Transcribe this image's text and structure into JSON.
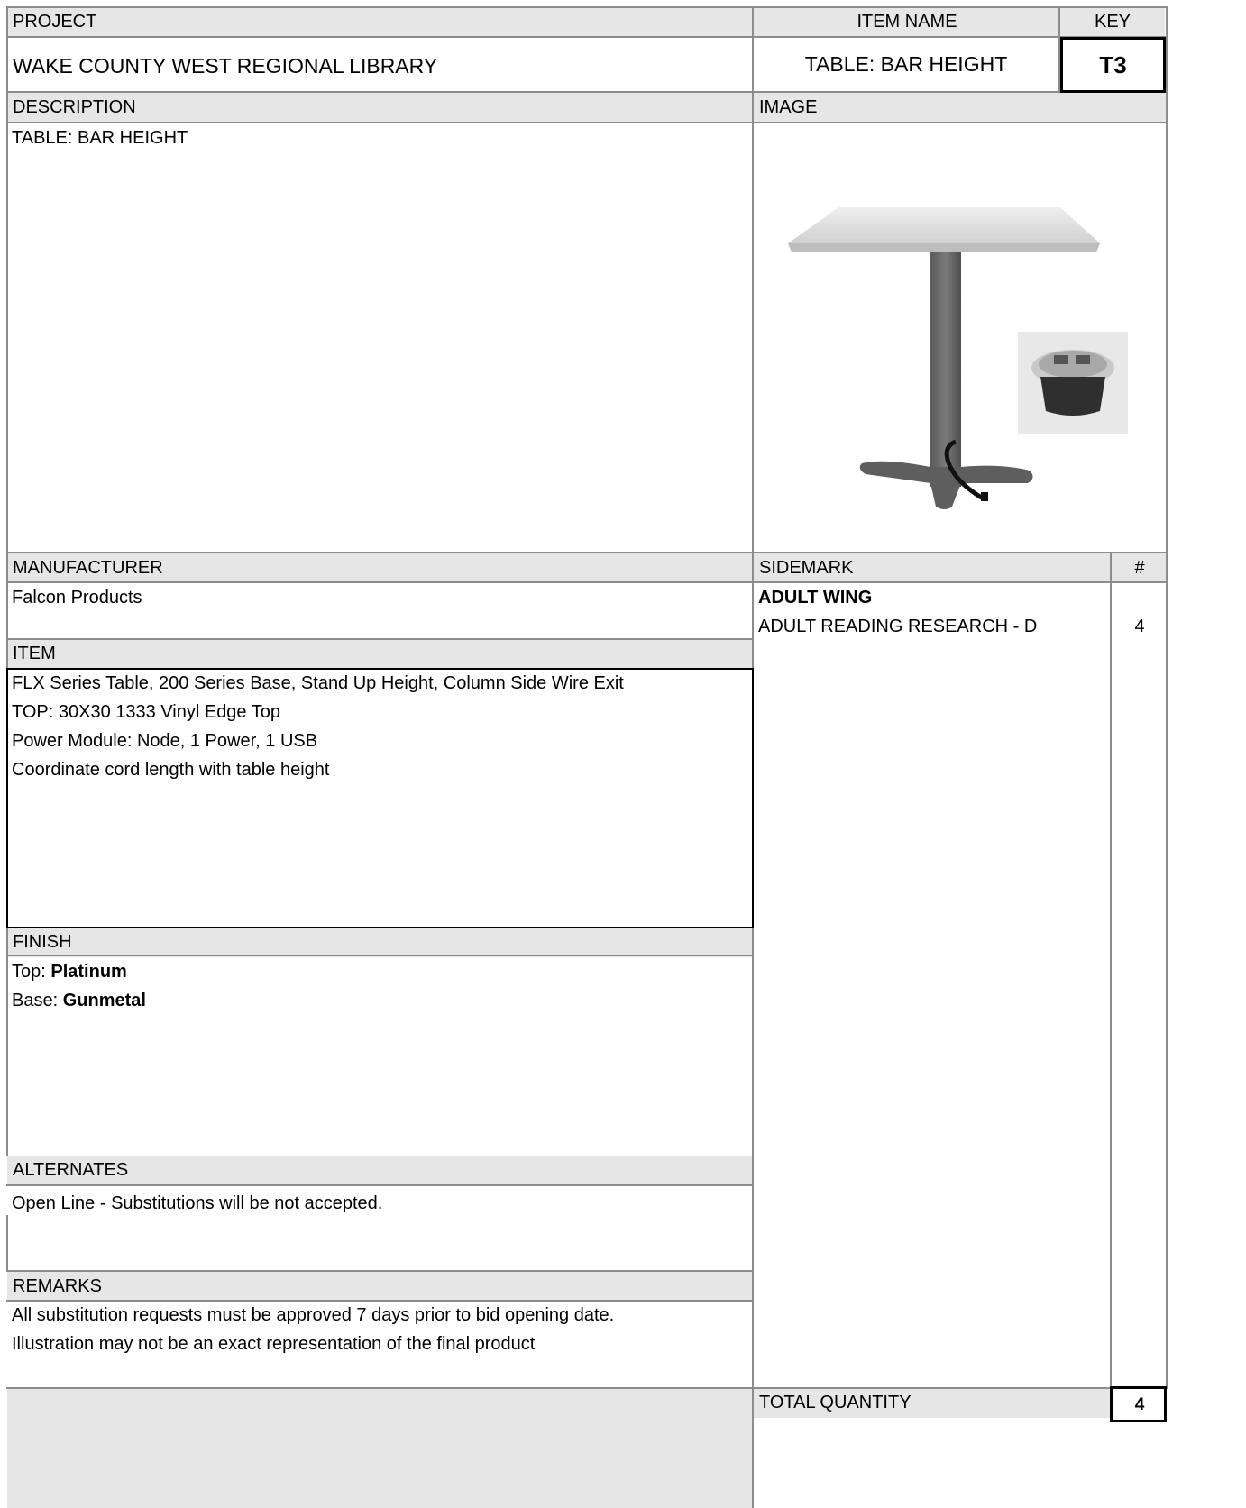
{
  "project": {
    "label": "PROJECT",
    "value": "WAKE COUNTY WEST REGIONAL LIBRARY"
  },
  "item_name": {
    "label": "ITEM NAME",
    "value": "TABLE: BAR HEIGHT"
  },
  "key": {
    "label": "KEY",
    "value": "T3"
  },
  "description": {
    "label": "DESCRIPTION",
    "value": "TABLE: BAR HEIGHT"
  },
  "image": {
    "label": "IMAGE",
    "main_icon": "bar-height-table-icon",
    "inset_icon": "power-module-icon",
    "colors": {
      "tabletop": "#e4e4e4",
      "base": "#606060",
      "inset_bg": "#e8e8e8"
    }
  },
  "manufacturer": {
    "label": "MANUFACTURER",
    "value": "Falcon Products"
  },
  "item": {
    "label": "ITEM",
    "lines": [
      "FLX Series Table, 200 Series Base, Stand Up Height, Column Side Wire Exit",
      "TOP: 30X30 1333 Vinyl Edge Top",
      "Power Module: Node, 1 Power, 1 USB",
      "Coordinate cord length with table height"
    ]
  },
  "finish": {
    "label": "FINISH",
    "top_label": "Top:",
    "top_value": "Platinum",
    "base_label": "Base:",
    "base_value": "Gunmetal"
  },
  "alternates": {
    "label": "ALTERNATES",
    "value": "Open Line - Substitutions will be not accepted."
  },
  "remarks": {
    "label": "REMARKS",
    "lines": [
      "All substitution requests must be approved 7 days prior to bid opening date.",
      "Illustration may not be an exact representation of the final product"
    ]
  },
  "sidemark": {
    "label": "SIDEMARK",
    "qty_label": "#",
    "group": "ADULT WING",
    "rows": [
      {
        "name": "ADULT READING RESEARCH - D",
        "qty": "4"
      }
    ]
  },
  "total": {
    "label": "TOTAL QUANTITY",
    "value": "4"
  }
}
